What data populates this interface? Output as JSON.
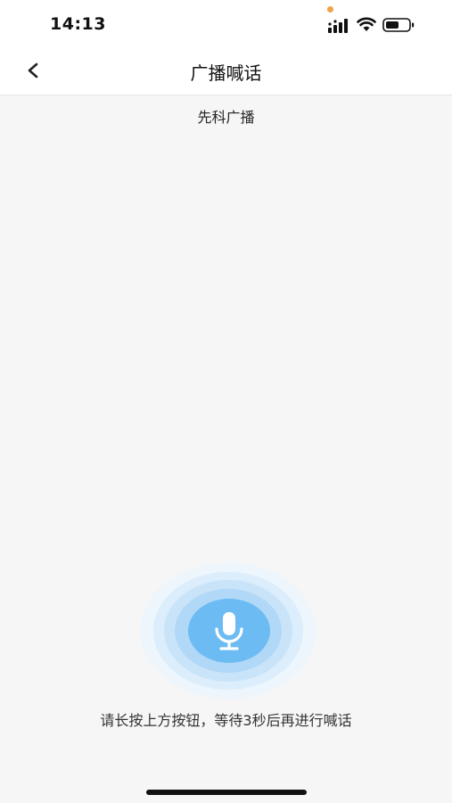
{
  "status_bar": {
    "time": "14:13",
    "icons": [
      "signal-icon",
      "wifi-icon",
      "battery-icon"
    ],
    "privacy_dot_color": "#f0a24a"
  },
  "nav": {
    "back_icon": "chevron-left-icon",
    "title": "广播喊话"
  },
  "channel": {
    "name": "先科广播"
  },
  "mic": {
    "icon": "microphone-icon",
    "button_color": "#6cbcf3"
  },
  "hint": "请长按上方按钮，等待3秒后再进行喊话"
}
